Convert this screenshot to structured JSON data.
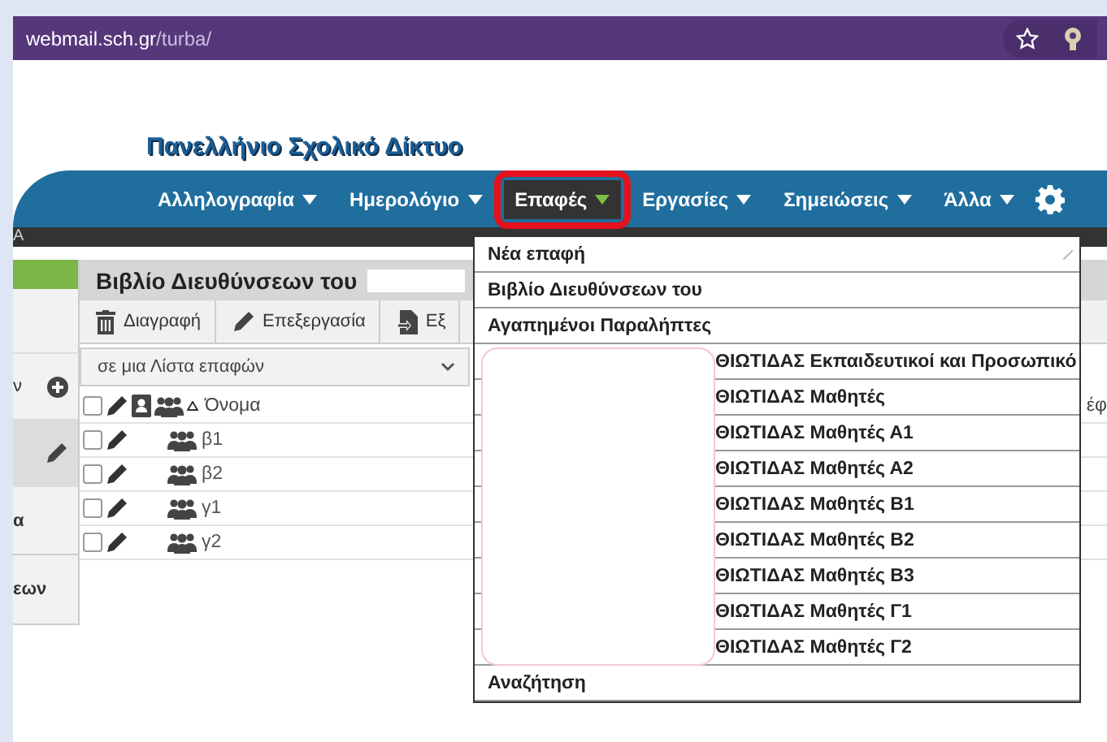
{
  "browser": {
    "url_host": "webmail.sch.gr",
    "url_path": "/turba/"
  },
  "site": {
    "title": "Πανελλήνιο Σχολικό Δίκτυο"
  },
  "nav": [
    {
      "label": "Αλληλογραφία",
      "selected": false,
      "highlighted": false
    },
    {
      "label": "Ημερολόγιο",
      "selected": false,
      "highlighted": false
    },
    {
      "label": "Επαφές",
      "selected": true,
      "highlighted": true
    },
    {
      "label": "Εργασίες",
      "selected": false,
      "highlighted": false
    },
    {
      "label": "Σημειώσεις",
      "selected": false,
      "highlighted": false
    },
    {
      "label": "Άλλα",
      "selected": false,
      "highlighted": false
    }
  ],
  "subbar": {
    "text": "Α"
  },
  "sidebar": {
    "items": [
      {
        "kind": "accent",
        "selected": false
      },
      {
        "kind": "blank",
        "selected": false
      },
      {
        "kind": "add",
        "text": "ν",
        "selected": false
      },
      {
        "kind": "edit",
        "selected": true
      },
      {
        "kind": "text",
        "text": "α",
        "selected": false
      },
      {
        "kind": "text",
        "text": "εων",
        "selected": false
      }
    ]
  },
  "addressbook": {
    "title": "Βιβλίο Διευθύνσεων του",
    "toolbar": [
      {
        "label": "Διαγραφή",
        "kind": "trash"
      },
      {
        "label": "Επεξεργασία",
        "kind": "pencil"
      },
      {
        "label": "Εξ",
        "kind": "export"
      }
    ],
    "filter": "σε μια Λίστα επαφών",
    "header": {
      "checked": false,
      "name": "Όνομα",
      "column_3": "έφ"
    },
    "rows": [
      {
        "name": "β1",
        "checked": false
      },
      {
        "name": "β2",
        "checked": false
      },
      {
        "name": "γ1",
        "checked": false
      },
      {
        "name": "γ2",
        "checked": false
      }
    ]
  },
  "menu": {
    "items": [
      {
        "kind": "plain",
        "label": "Νέα επαφή"
      },
      {
        "kind": "plain",
        "label": "Βιβλίο Διευθύνσεων του"
      },
      {
        "kind": "plain",
        "label": "Αγαπημένοι Παραλήπτες"
      },
      {
        "kind": "covered",
        "label": "ΘΙΩΤΙΔΑΣ Εκπαιδευτικοί και Προσωπικό"
      },
      {
        "kind": "covered",
        "label": "ΘΙΩΤΙΔΑΣ Μαθητές"
      },
      {
        "kind": "covered",
        "label": "ΘΙΩΤΙΔΑΣ Μαθητές Α1"
      },
      {
        "kind": "covered",
        "label": "ΘΙΩΤΙΔΑΣ Μαθητές Α2"
      },
      {
        "kind": "covered",
        "label": "ΘΙΩΤΙΔΑΣ Μαθητές Β1"
      },
      {
        "kind": "covered",
        "label": "ΘΙΩΤΙΔΑΣ Μαθητές Β2"
      },
      {
        "kind": "covered",
        "label": "ΘΙΩΤΙΔΑΣ Μαθητές Β3"
      },
      {
        "kind": "covered",
        "label": "ΘΙΩΤΙΔΑΣ Μαθητές Γ1"
      },
      {
        "kind": "covered",
        "label": "ΘΙΩΤΙΔΑΣ Μαθητές Γ2"
      },
      {
        "kind": "plain",
        "label": "Αναζήτηση"
      }
    ]
  }
}
